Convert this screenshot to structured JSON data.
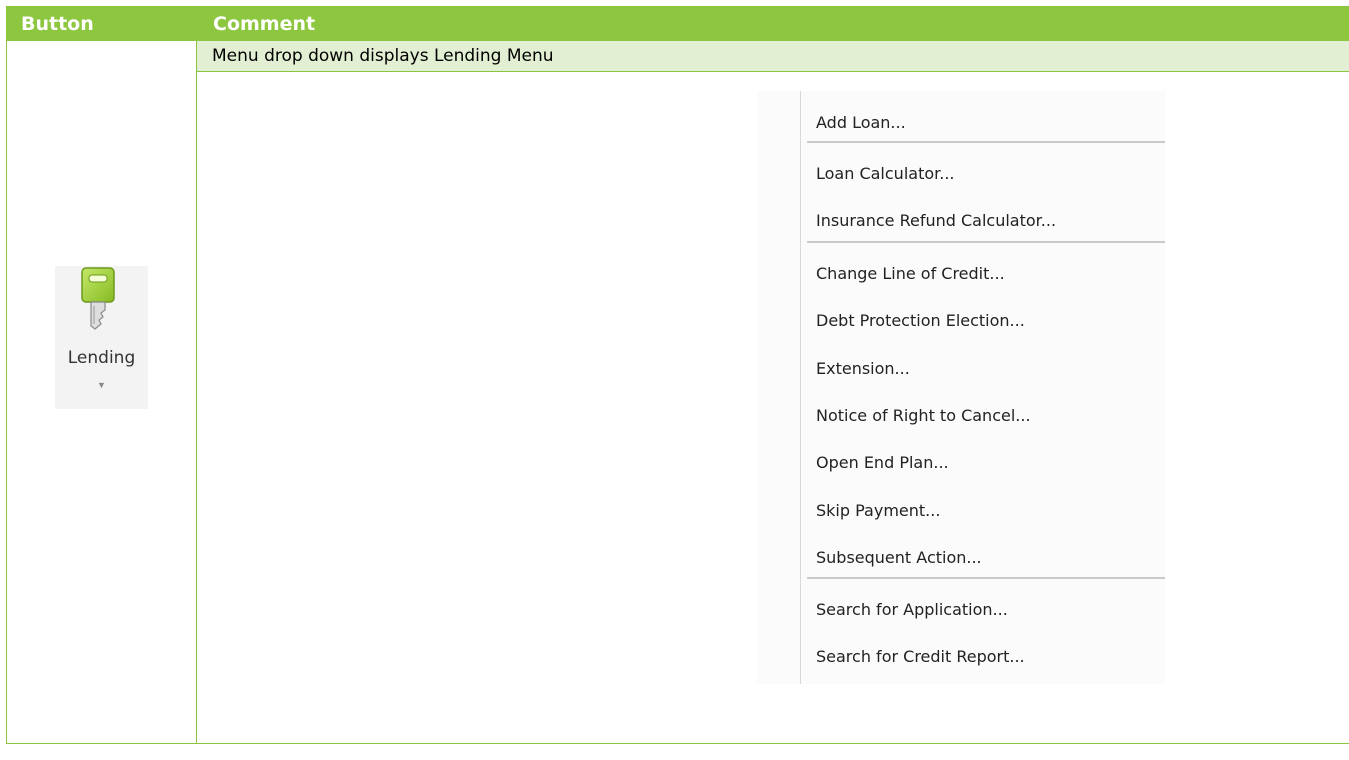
{
  "table": {
    "header": {
      "button_col": "Button",
      "comment_col": "Comment"
    },
    "row": {
      "comment": "Menu drop down displays Lending Menu"
    }
  },
  "ribbon_button": {
    "label": "Lending",
    "icon": "key-icon",
    "arrow": "▼"
  },
  "menu": {
    "items": [
      "Add Loan...",
      "Loan Calculator...",
      "Insurance Refund Calculator...",
      "Change Line of Credit...",
      "Debt Protection Election...",
      "Extension...",
      "Notice of Right to Cancel...",
      "Open End Plan...",
      "Skip Payment...",
      "Subsequent Action...",
      "Search for Application...",
      "Search for Credit Report..."
    ]
  },
  "colors": {
    "header_bg": "#8dc63f",
    "comment_bg": "#e3efd3",
    "border": "#8cc641",
    "key_green": "#a8d63c"
  }
}
